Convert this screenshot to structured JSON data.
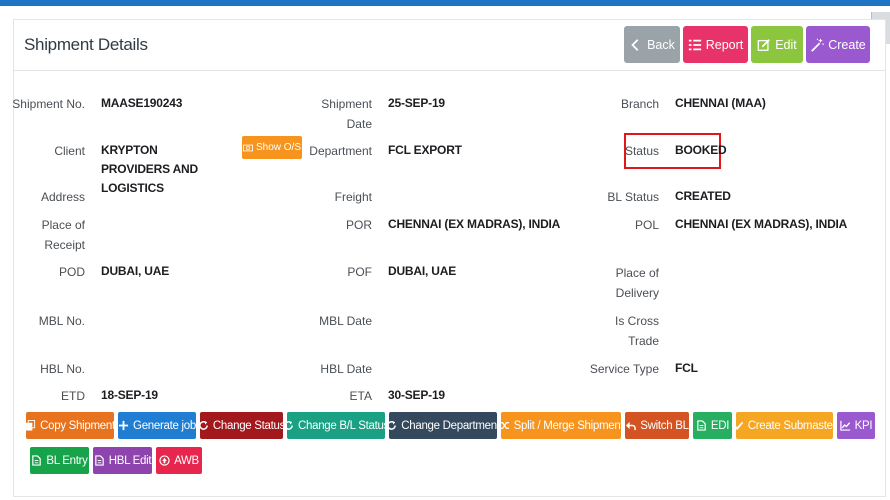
{
  "panel": {
    "title": "Shipment Details"
  },
  "toolbar": {
    "back_label": "Back",
    "back_icon": "chevron-left-icon",
    "report_label": "Report",
    "report_icon": "list-icon",
    "edit_label": "Edit",
    "edit_icon": "edit-icon",
    "create_label": "Create",
    "create_icon": "magic-wand-icon"
  },
  "colors": {
    "topbar": "#1f74c4",
    "back": "#9aa3a7",
    "report": "#e8336a",
    "edit": "#8cc63f",
    "create": "#9b59d0",
    "status_highlight": "#e0161b"
  },
  "fields": {
    "shipment_no": {
      "label": "Shipment No.",
      "value": "MAASE190243"
    },
    "shipment_date": {
      "label": "Shipment Date",
      "value": "25-SEP-19"
    },
    "branch": {
      "label": "Branch",
      "value": "CHENNAI (MAA)"
    },
    "client": {
      "label": "Client",
      "value": "KRYPTON PROVIDERS AND LOGISTICS"
    },
    "department": {
      "label": "Department",
      "value": "FCL EXPORT"
    },
    "status": {
      "label": "Status",
      "value": "BOOKED"
    },
    "address": {
      "label": "Address",
      "value": ""
    },
    "freight": {
      "label": "Freight",
      "value": ""
    },
    "bl_status": {
      "label": "BL Status",
      "value": "CREATED"
    },
    "place_of_receipt": {
      "label": "Place of Receipt",
      "value": ""
    },
    "por": {
      "label": "POR",
      "value": "CHENNAI (EX MADRAS), INDIA"
    },
    "pol": {
      "label": "POL",
      "value": "CHENNAI (EX MADRAS), INDIA"
    },
    "pod": {
      "label": "POD",
      "value": "DUBAI, UAE"
    },
    "pof": {
      "label": "POF",
      "value": "DUBAI, UAE"
    },
    "place_of_delivery": {
      "label": "Place of Delivery",
      "value": ""
    },
    "mbl_no": {
      "label": "MBL No.",
      "value": ""
    },
    "mbl_date": {
      "label": "MBL Date",
      "value": ""
    },
    "is_cross_trade": {
      "label": "Is Cross Trade",
      "value": ""
    },
    "hbl_no": {
      "label": "HBL No.",
      "value": ""
    },
    "hbl_date": {
      "label": "HBL Date",
      "value": ""
    },
    "service_type": {
      "label": "Service Type",
      "value": "FCL"
    },
    "etd": {
      "label": "ETD",
      "value": "18-SEP-19"
    },
    "eta": {
      "label": "ETA",
      "value": "30-SEP-19"
    }
  },
  "show_os": {
    "label": "Show O/S",
    "icon": "money-icon",
    "color": "#f7941d"
  },
  "actions": [
    {
      "label": "Copy Shipment",
      "icon": "copy-icon",
      "color": "#e8731e"
    },
    {
      "label": "Generate job",
      "icon": "plus-icon",
      "color": "#1f7ed1"
    },
    {
      "label": "Change Status",
      "icon": "refresh-icon",
      "color": "#a3181c"
    },
    {
      "label": "Change B/L Status",
      "icon": "refresh-icon",
      "color": "#1aa184"
    },
    {
      "label": "Change Department",
      "icon": "refresh-icon",
      "color": "#34495e"
    },
    {
      "label": "Split / Merge Shipment",
      "icon": "shuffle-icon",
      "color": "#f7941d"
    },
    {
      "label": "Switch BL",
      "icon": "reply-icon",
      "color": "#d35422"
    },
    {
      "label": "EDI",
      "icon": "file-icon",
      "color": "#27ae60"
    },
    {
      "label": "Create Submaster",
      "icon": "check-icon",
      "color": "#f5a623"
    },
    {
      "label": "KPI",
      "icon": "chart-icon",
      "color": "#9b59d0"
    },
    {
      "label": "BL Entry",
      "icon": "file-icon",
      "color": "#16a34a"
    },
    {
      "label": "HBL Edit",
      "icon": "file-icon",
      "color": "#8e44ad"
    },
    {
      "label": "AWB",
      "icon": "circle-arrow-icon",
      "color": "#e6264d"
    }
  ]
}
